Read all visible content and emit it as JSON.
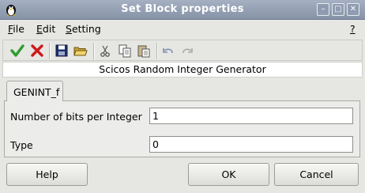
{
  "window": {
    "title": "Set Block properties",
    "buttons": {
      "minimize": "–",
      "maximize": "□",
      "close": "✕"
    }
  },
  "menubar": {
    "file": {
      "mnemonic": "F",
      "rest": "ile"
    },
    "edit": {
      "mnemonic": "E",
      "rest": "dit"
    },
    "setting": {
      "mnemonic": "S",
      "rest": "etting"
    },
    "help": {
      "mnemonic": "?"
    }
  },
  "toolbar": {
    "icons": [
      "check-icon",
      "cross-icon",
      "save-icon",
      "open-folder-icon",
      "cut-icon",
      "copy-icon",
      "paste-icon",
      "undo-icon",
      "redo-icon"
    ]
  },
  "block": {
    "title": "Scicos Random Integer Generator"
  },
  "tab": {
    "label": "GENINT_f"
  },
  "params": [
    {
      "label": "Number of bits per Integer",
      "value": "1"
    },
    {
      "label": "Type",
      "value": "0"
    }
  ],
  "buttons": {
    "help": "Help",
    "ok": "OK",
    "cancel": "Cancel"
  },
  "colors": {
    "titlebar": "#8f9bb0",
    "check": "#2f9b2f",
    "cross": "#cc1b1b"
  }
}
